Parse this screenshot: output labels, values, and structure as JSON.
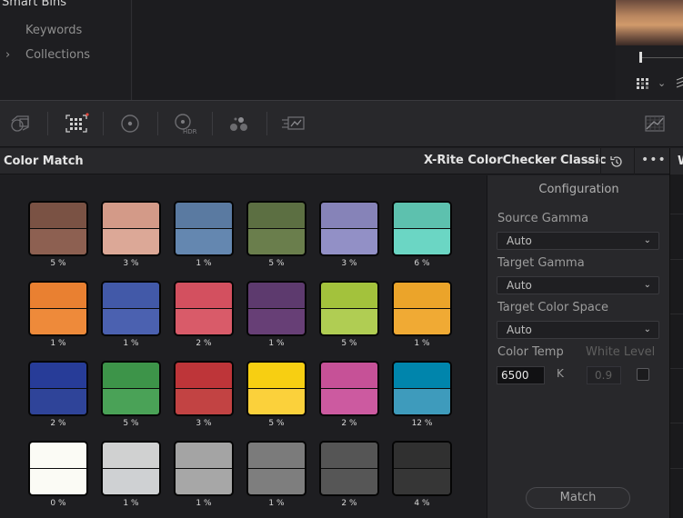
{
  "bins": {
    "title": "Smart Bins",
    "items": [
      {
        "label": "Keywords"
      },
      {
        "label": "Collections",
        "chevron": "›"
      }
    ]
  },
  "viewer": {
    "grid_chevron": "⌄",
    "scrub_level": 0.05
  },
  "toolbar": {
    "icons": [
      "camera-raw-icon",
      "color-match-icon",
      "color-wheels-icon",
      "hdr-wheels-icon",
      "rgb-mixer-icon",
      "motion-effects-icon",
      "scopes-icon"
    ],
    "active_indicator_color": "#e0463c"
  },
  "color_match": {
    "title": "Color Match",
    "chart_name": "X-Rite ColorChecker Classic",
    "chart_chevron": "⌄",
    "more": "•••",
    "right_panel_label": "W"
  },
  "swatches": [
    {
      "top": "#7a5244",
      "bottom": "#8d6051",
      "percent": "5 %"
    },
    {
      "top": "#d39a88",
      "bottom": "#dca897",
      "percent": "3 %"
    },
    {
      "top": "#5a7aa1",
      "bottom": "#6487b0",
      "percent": "1 %"
    },
    {
      "top": "#5c6f42",
      "bottom": "#6a7e4c",
      "percent": "5 %"
    },
    {
      "top": "#8683b8",
      "bottom": "#9290c6",
      "percent": "3 %"
    },
    {
      "top": "#5dc1ae",
      "bottom": "#6bd6c4",
      "percent": "6 %"
    },
    {
      "top": "#e98031",
      "bottom": "#ee8a3a",
      "percent": "1 %"
    },
    {
      "top": "#4259a8",
      "bottom": "#4b61b0",
      "percent": "1 %"
    },
    {
      "top": "#d3505f",
      "bottom": "#d95b69",
      "percent": "2 %"
    },
    {
      "top": "#5d3a6e",
      "bottom": "#673f76",
      "percent": "1 %"
    },
    {
      "top": "#a3c23c",
      "bottom": "#b0cd53",
      "percent": "5 %"
    },
    {
      "top": "#eba42a",
      "bottom": "#f0aa34",
      "percent": "1 %"
    },
    {
      "top": "#273c98",
      "bottom": "#2f4499",
      "percent": "2 %"
    },
    {
      "top": "#3d9449",
      "bottom": "#4aa257",
      "percent": "5 %"
    },
    {
      "top": "#be3539",
      "bottom": "#c24343",
      "percent": "3 %"
    },
    {
      "top": "#f7cf12",
      "bottom": "#fbd13b",
      "percent": "5 %"
    },
    {
      "top": "#c65197",
      "bottom": "#cc5aa0",
      "percent": "2 %"
    },
    {
      "top": "#0085ac",
      "bottom": "#3e9bbc",
      "percent": "12 %"
    },
    {
      "top": "#fbfbf5",
      "bottom": "#fbfbf5",
      "percent": "0 %"
    },
    {
      "top": "#d0d1d1",
      "bottom": "#cfd1d3",
      "percent": "1 %"
    },
    {
      "top": "#a4a4a4",
      "bottom": "#a7a7a7",
      "percent": "1 %"
    },
    {
      "top": "#7b7b7b",
      "bottom": "#7e7e7e",
      "percent": "1 %"
    },
    {
      "top": "#555555",
      "bottom": "#565656",
      "percent": "2 %"
    },
    {
      "top": "#303030",
      "bottom": "#363636",
      "percent": "4 %"
    }
  ],
  "configuration": {
    "title": "Configuration",
    "source_gamma": {
      "label": "Source Gamma",
      "value": "Auto",
      "chevron": "⌄"
    },
    "target_gamma": {
      "label": "Target Gamma",
      "value": "Auto",
      "chevron": "⌄"
    },
    "target_color_space": {
      "label": "Target Color Space",
      "value": "Auto",
      "chevron": "⌄"
    },
    "color_temp": {
      "label": "Color Temp",
      "value": "6500",
      "unit": "K"
    },
    "white_level": {
      "label": "White Level",
      "value": "0.9",
      "checked": false
    },
    "match_label": "Match"
  }
}
